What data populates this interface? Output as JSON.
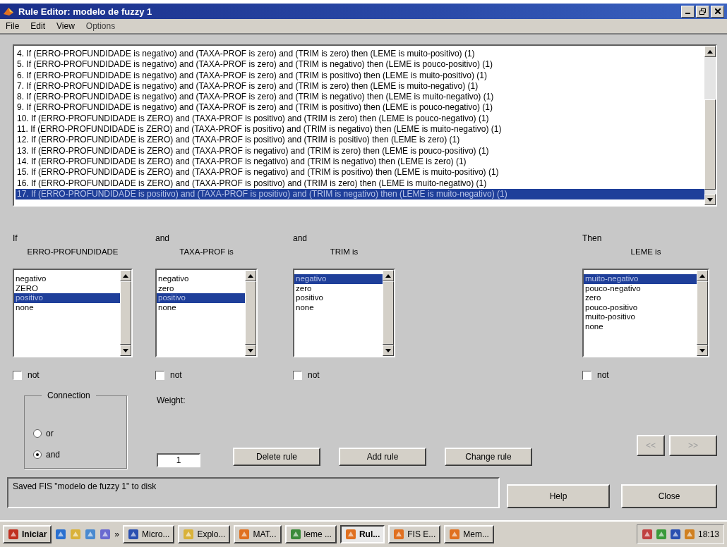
{
  "window": {
    "title": "Rule Editor: modelo de fuzzy 1"
  },
  "menu": [
    {
      "label": "File"
    },
    {
      "label": "Edit"
    },
    {
      "label": "View"
    },
    {
      "label": "Options"
    }
  ],
  "rules": [
    {
      "text": "4. If (ERRO-PROFUNDIDADE is negativo) and (TAXA-PROF is zero) and (TRIM is zero) then (LEME is muito-positivo) (1)",
      "selected": false
    },
    {
      "text": "5. If (ERRO-PROFUNDIDADE is negativo) and (TAXA-PROF is zero) and (TRIM is negativo) then (LEME is pouco-positivo) (1)",
      "selected": false
    },
    {
      "text": "6. If (ERRO-PROFUNDIDADE is negativo) and (TAXA-PROF is zero) and (TRIM is positivo) then (LEME is muito-positivo) (1)",
      "selected": false
    },
    {
      "text": "7. If (ERRO-PROFUNDIDADE is negativo) and (TAXA-PROF is zero) and (TRIM is zero) then (LEME is muito-negativo) (1)",
      "selected": false
    },
    {
      "text": "8. If (ERRO-PROFUNDIDADE is negativo) and (TAXA-PROF is zero) and (TRIM is negativo) then (LEME is muito-negativo) (1)",
      "selected": false
    },
    {
      "text": "9. If (ERRO-PROFUNDIDADE is negativo) and (TAXA-PROF is zero) and (TRIM is positivo) then (LEME is pouco-negativo) (1)",
      "selected": false
    },
    {
      "text": "10. If (ERRO-PROFUNDIDADE is ZERO) and (TAXA-PROF is positivo) and (TRIM is zero) then (LEME is pouco-negativo) (1)",
      "selected": false
    },
    {
      "text": "11. If (ERRO-PROFUNDIDADE is ZERO) and (TAXA-PROF is positivo) and (TRIM is negativo) then (LEME is muito-negativo) (1)",
      "selected": false
    },
    {
      "text": "12. If (ERRO-PROFUNDIDADE is ZERO) and (TAXA-PROF is positivo) and (TRIM is positivo) then (LEME is zero) (1)",
      "selected": false
    },
    {
      "text": "13. If (ERRO-PROFUNDIDADE is ZERO) and (TAXA-PROF is negativo) and (TRIM is zero) then (LEME is pouco-positivo) (1)",
      "selected": false
    },
    {
      "text": "14. If (ERRO-PROFUNDIDADE is ZERO) and (TAXA-PROF is negativo) and (TRIM is negativo) then (LEME is zero) (1)",
      "selected": false
    },
    {
      "text": "15. If (ERRO-PROFUNDIDADE is ZERO) and (TAXA-PROF is negativo) and (TRIM is positivo) then (LEME is muito-positivo) (1)",
      "selected": false
    },
    {
      "text": "16. If (ERRO-PROFUNDIDADE is ZERO) and (TAXA-PROF is positivo) and (TRIM is zero) then (LEME is muito-negativo) (1)",
      "selected": false
    },
    {
      "text": "17. If (ERRO-PROFUNDIDADE is positivo) and (TAXA-PROF is positivo) and (TRIM is negativo) then (LEME is muito-negativo) (1)",
      "selected": true
    }
  ],
  "variables": [
    {
      "prefix": "If",
      "label": "ERRO-PROFUNDIDADE",
      "options": [
        {
          "label": "negativo",
          "selected": false
        },
        {
          "label": "ZERO",
          "selected": false
        },
        {
          "label": "positivo",
          "selected": true
        },
        {
          "label": "none",
          "selected": false
        }
      ],
      "not": {
        "label": "not",
        "checked": false
      }
    },
    {
      "prefix": "and",
      "label": "TAXA-PROF is",
      "options": [
        {
          "label": "negativo",
          "selected": false
        },
        {
          "label": "zero",
          "selected": false
        },
        {
          "label": "positivo",
          "selected": true
        },
        {
          "label": "none",
          "selected": false
        }
      ],
      "not": {
        "label": "not",
        "checked": false
      }
    },
    {
      "prefix": "and",
      "label": "TRIM is",
      "options": [
        {
          "label": "negativo",
          "selected": true
        },
        {
          "label": "zero",
          "selected": false
        },
        {
          "label": "positivo",
          "selected": false
        },
        {
          "label": "none",
          "selected": false
        }
      ],
      "not": {
        "label": "not",
        "checked": false
      }
    },
    {
      "prefix": "Then",
      "label": "LEME is",
      "options": [
        {
          "label": "muito-negativo",
          "selected": true
        },
        {
          "label": "pouco-negativo",
          "selected": false
        },
        {
          "label": "zero",
          "selected": false
        },
        {
          "label": "pouco-positivo",
          "selected": false
        },
        {
          "label": "muito-positivo",
          "selected": false
        },
        {
          "label": "none",
          "selected": false
        }
      ],
      "not": {
        "label": "not",
        "checked": false
      }
    }
  ],
  "connection": {
    "title": "Connection",
    "options": [
      {
        "label": "or",
        "selected": false
      },
      {
        "label": "and",
        "selected": true
      }
    ]
  },
  "weight": {
    "label": "Weight:",
    "value": "1"
  },
  "rule_buttons": [
    {
      "label": "Delete rule"
    },
    {
      "label": "Add rule"
    },
    {
      "label": "Change rule"
    }
  ],
  "nav_buttons": [
    {
      "label": "<<",
      "disabled": true
    },
    {
      "label": ">>",
      "disabled": true
    }
  ],
  "status": "Saved FIS \"modelo de fuzzy 1\" to disk",
  "footer_buttons": [
    {
      "label": "Help"
    },
    {
      "label": "Close"
    }
  ],
  "taskbar": {
    "start": "Iniciar",
    "more": "»",
    "tasks": [
      {
        "label": "Micro...",
        "selected": false
      },
      {
        "label": "Explo...",
        "selected": false
      },
      {
        "label": "MAT...",
        "selected": false
      },
      {
        "label": "leme ...",
        "selected": false
      },
      {
        "label": "Rul...",
        "selected": true
      },
      {
        "label": "FIS E...",
        "selected": false
      },
      {
        "label": "Mem...",
        "selected": false
      }
    ],
    "time": "18:13"
  }
}
